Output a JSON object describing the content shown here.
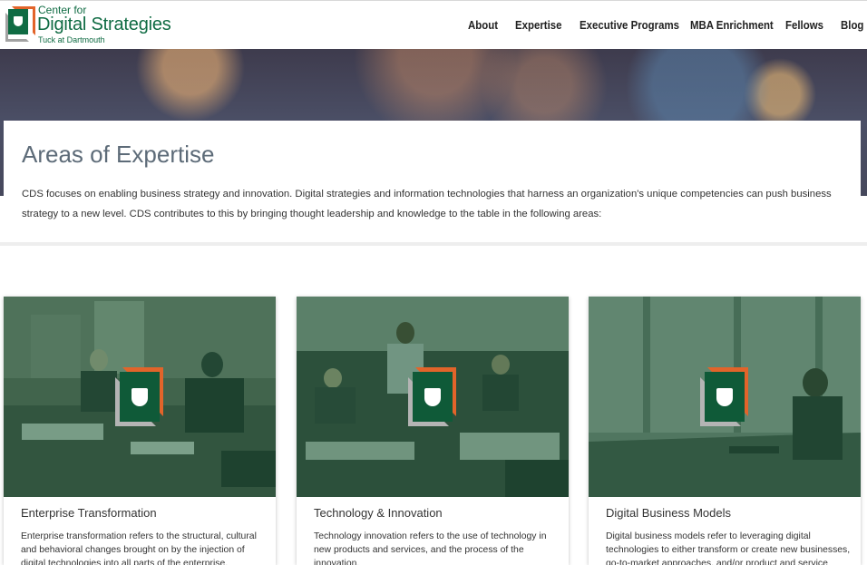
{
  "header": {
    "logo": {
      "top_line": "Center for",
      "main_line": "Digital Strategies",
      "sub_line": "Tuck at Dartmouth"
    },
    "nav": [
      {
        "label": "About"
      },
      {
        "label": "Expertise"
      },
      {
        "label": "Executive Programs"
      },
      {
        "label": "MBA Enrichment"
      },
      {
        "label": "Fellows"
      },
      {
        "label": "Blog"
      }
    ]
  },
  "intro": {
    "title": "Areas of Expertise",
    "text": "CDS focuses on enabling business strategy and innovation. Digital strategies and information technologies that harness an organization's unique competencies can push business strategy to a new level. CDS contributes to this by bringing thought leadership and knowledge to the table in the following areas:"
  },
  "cards": [
    {
      "title": "Enterprise Transformation",
      "text": "Enterprise transformation refers to the structural, cultural and behavioral changes brought on by the injection of digital technologies into all parts of the enterprise."
    },
    {
      "title": "Technology & Innovation",
      "text": "Technology innovation refers to the use of technology in new products and services, and the process of the innovation."
    },
    {
      "title": "Digital Business Models",
      "text": "Digital business models refer to leveraging digital technologies to either transform or create new businesses, go-to-market approaches, and/or product and service offerings."
    }
  ],
  "colors": {
    "brand_green": "#0f6b43",
    "brand_orange": "#e2642a",
    "brand_gray": "#a2a2a2",
    "heading_gray": "#5d6b78"
  }
}
